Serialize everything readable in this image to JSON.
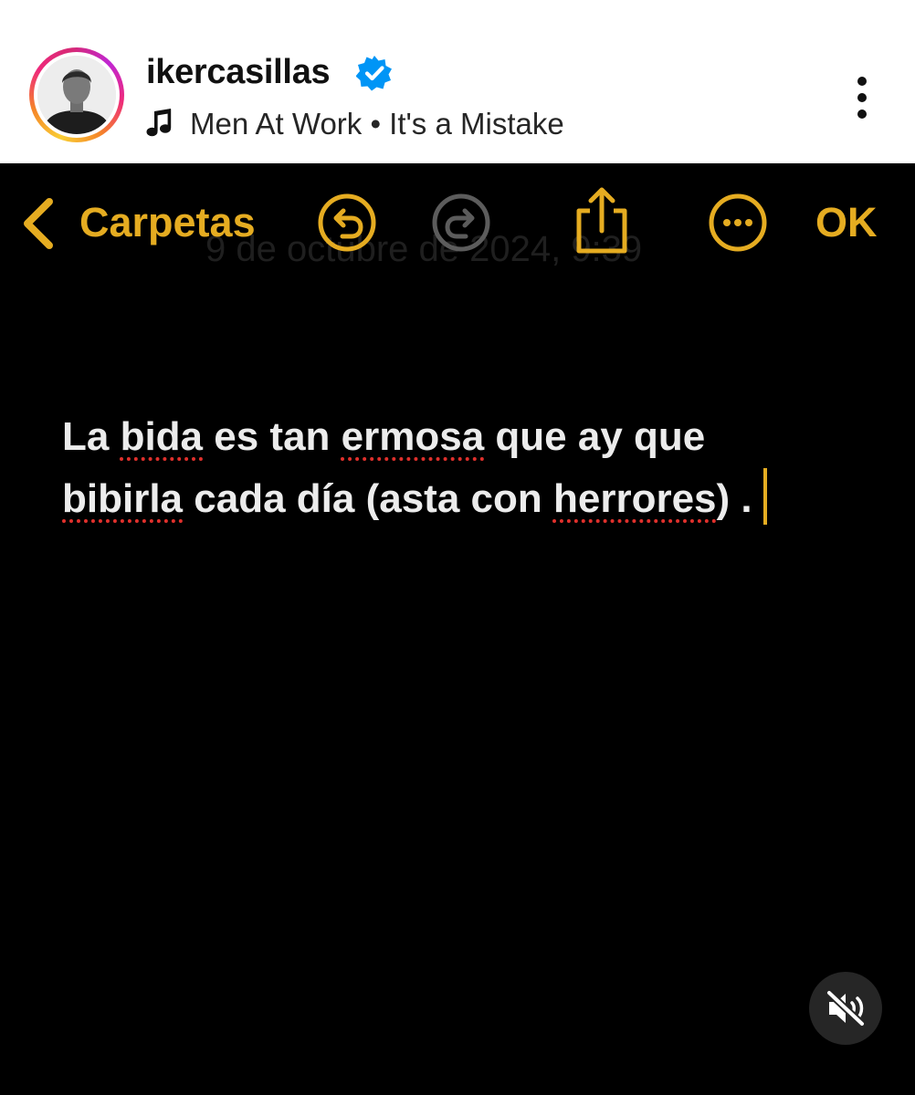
{
  "post": {
    "username": "ikercasillas",
    "music_line": "Men At Work • It's a Mistake",
    "icons": {
      "verified": "verified-badge-icon",
      "music": "music-note-icon",
      "more": "vertical-ellipsis-icon"
    }
  },
  "notes_app": {
    "toolbar": {
      "back_label": "Carpetas",
      "ok_label": "OK",
      "icons": [
        "chevron-left-icon",
        "undo-icon",
        "redo-icon",
        "share-icon",
        "more-circle-icon"
      ]
    },
    "faded_date": "9 de octubre de 2024, 9:39",
    "note_lines": [
      [
        {
          "text": "La ",
          "misspelled": false
        },
        {
          "text": "bida",
          "misspelled": true
        },
        {
          "text": " es tan ",
          "misspelled": false
        },
        {
          "text": "ermosa",
          "misspelled": true
        },
        {
          "text": " que ay que",
          "misspelled": false
        }
      ],
      [
        {
          "text": "bibirla",
          "misspelled": true
        },
        {
          "text": " cada día (asta con ",
          "misspelled": false
        },
        {
          "text": "herrores",
          "misspelled": true
        },
        {
          "text": ") .",
          "misspelled": false
        }
      ]
    ]
  },
  "media_controls": {
    "mute_icon": "speaker-muted-icon"
  },
  "colors": {
    "accent": "#e5ac21",
    "verified": "#0095f6",
    "spellcheck": "#e0302c",
    "note_background": "#000000",
    "note_text": "#ececec"
  }
}
